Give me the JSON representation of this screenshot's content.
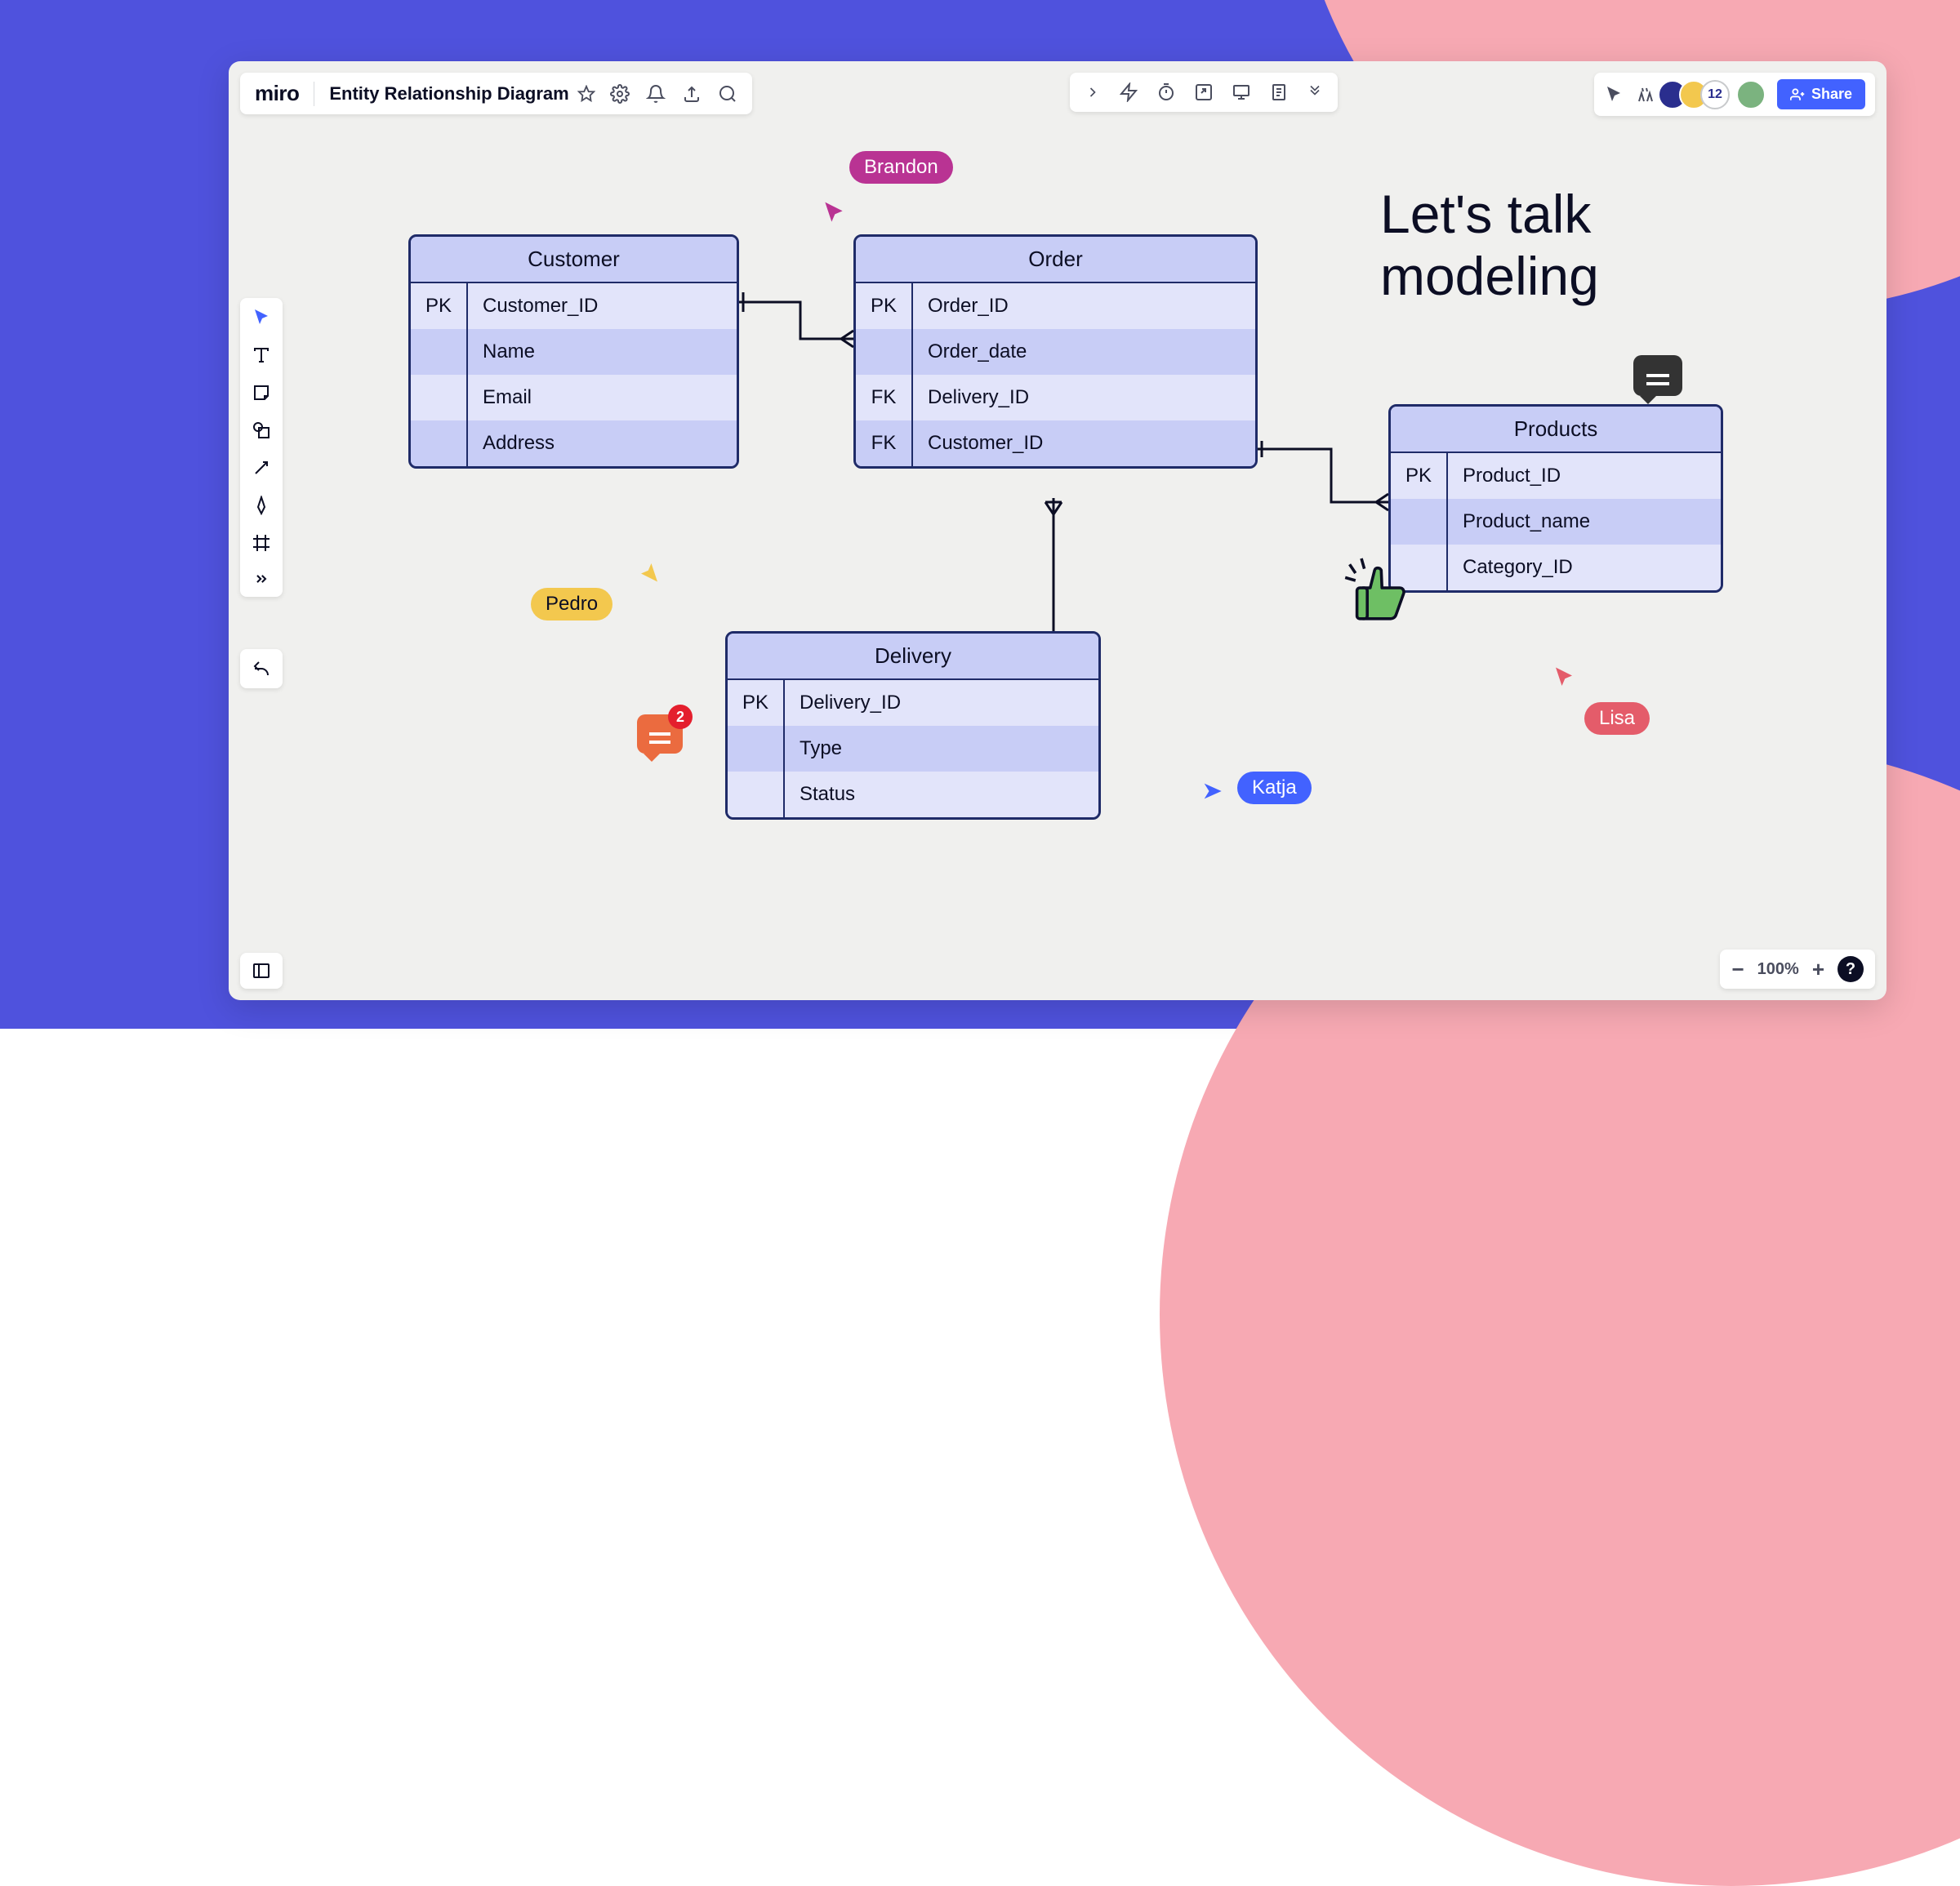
{
  "app": {
    "logo": "miro",
    "board_title": "Entity Relationship Diagram"
  },
  "zoom": {
    "level": "100%"
  },
  "avatar_count": "12",
  "share_label": "Share",
  "callout": {
    "line1": "Let's talk",
    "line2": "modeling"
  },
  "cursors": {
    "brandon": "Brandon",
    "pedro": "Pedro",
    "katja": "Katja",
    "lisa": "Lisa"
  },
  "comment_badge": "2",
  "entities": {
    "customer": {
      "title": "Customer",
      "rows": [
        {
          "key": "PK",
          "val": "Customer_ID"
        },
        {
          "key": "",
          "val": "Name"
        },
        {
          "key": "",
          "val": "Email"
        },
        {
          "key": "",
          "val": "Address"
        }
      ]
    },
    "order": {
      "title": "Order",
      "rows": [
        {
          "key": "PK",
          "val": "Order_ID"
        },
        {
          "key": "",
          "val": "Order_date"
        },
        {
          "key": "FK",
          "val": "Delivery_ID"
        },
        {
          "key": "FK",
          "val": "Customer_ID"
        }
      ]
    },
    "delivery": {
      "title": "Delivery",
      "rows": [
        {
          "key": "PK",
          "val": "Delivery_ID"
        },
        {
          "key": "",
          "val": "Type"
        },
        {
          "key": "",
          "val": "Status"
        }
      ]
    },
    "products": {
      "title": "Products",
      "rows": [
        {
          "key": "PK",
          "val": "Product_ID"
        },
        {
          "key": "",
          "val": "Product_name"
        },
        {
          "key": "",
          "val": "Category_ID"
        }
      ]
    }
  }
}
